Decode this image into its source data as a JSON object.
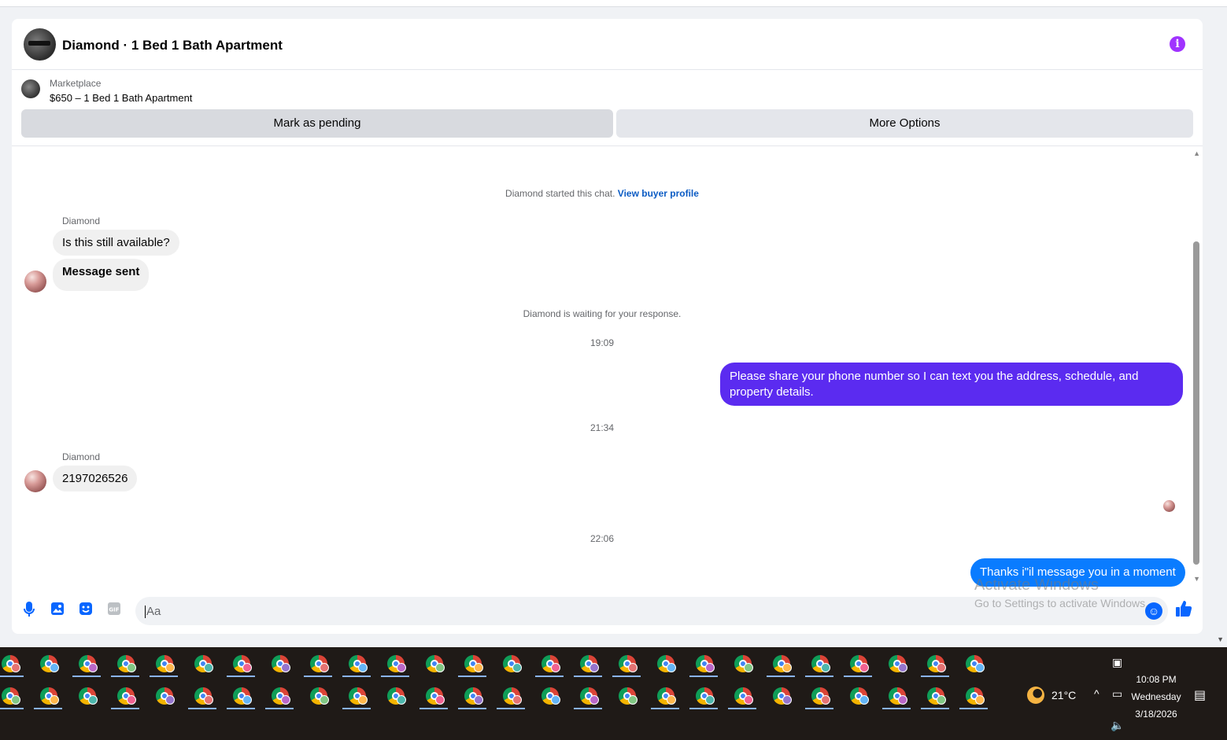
{
  "header": {
    "title": "Diamond · 1 Bed 1 Bath Apartment"
  },
  "marketplace": {
    "label": "Marketplace",
    "item": "$650 – 1 Bed 1 Bath Apartment",
    "mark_pending": "Mark as pending",
    "more_options": "More Options"
  },
  "thread": {
    "started": "Diamond started this chat.",
    "view_profile": "View buyer profile",
    "sender1": "Diamond",
    "msg1": "Is this still available?",
    "msg2": "Message sent",
    "waiting": "Diamond is waiting for your response.",
    "time1": "19:09",
    "out1": "Please share your phone number so I can text you the address, schedule, and property details.",
    "time2": "21:34",
    "sender2": "Diamond",
    "msg3": "2197026526",
    "time3": "22:06",
    "out2": "Thanks i\"il message you in a moment"
  },
  "composer": {
    "placeholder": "Aa"
  },
  "watermark": {
    "line1": "Activate Windows",
    "line2": "Go to Settings to activate Windows."
  },
  "taskbar": {
    "temperature": "21°C",
    "time": "10:08 PM",
    "day": "Wednesday",
    "date": "3/18/2026"
  },
  "colors": {
    "accent": "#0866ff",
    "outgoing_purple": "#5b2bf0",
    "outgoing_blue": "#0a7cff",
    "info": "#a033ff"
  }
}
